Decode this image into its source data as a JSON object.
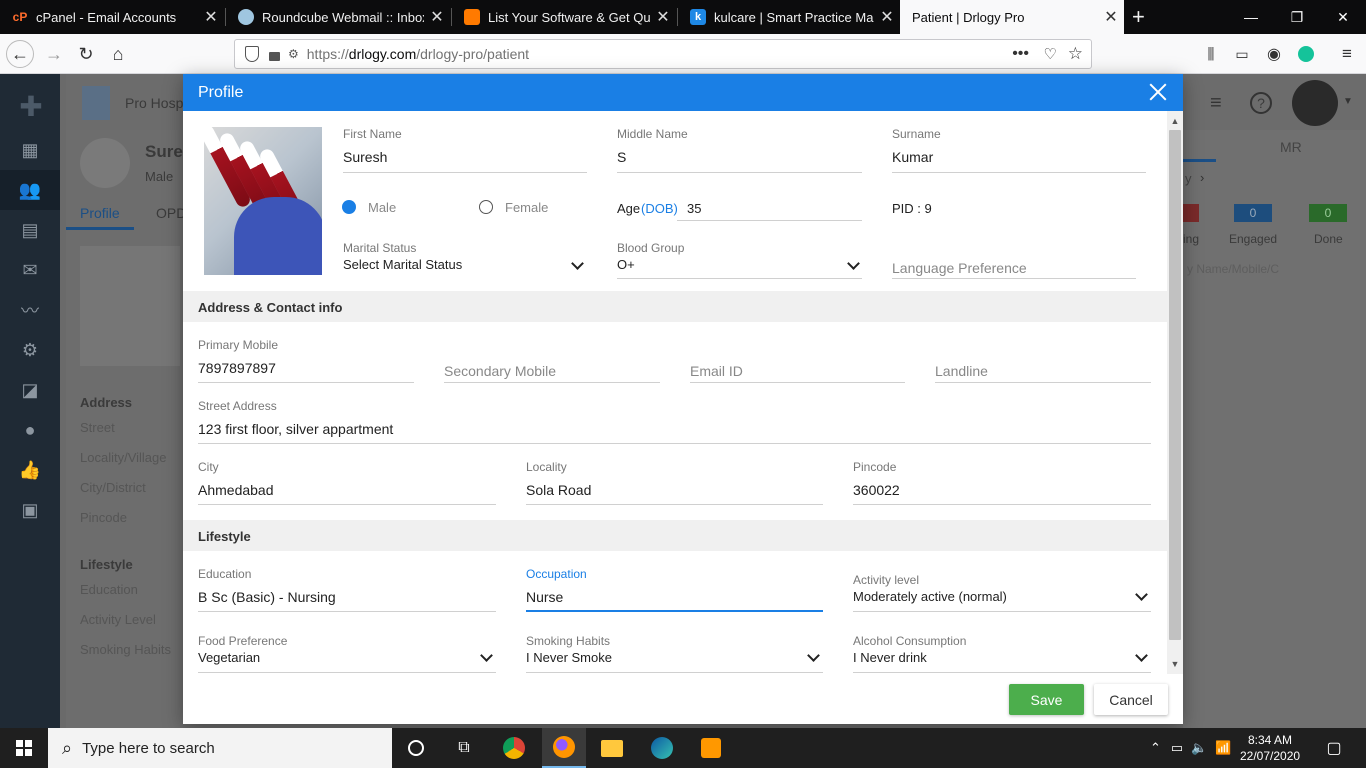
{
  "browser": {
    "tabs": [
      {
        "label": "cPanel - Email Accounts",
        "icon": "cpanel-icon",
        "color": "#ff6c2c"
      },
      {
        "label": "Roundcube Webmail :: Inbox",
        "icon": "roundcube-icon",
        "color": "#9fc6e0"
      },
      {
        "label": "List Your Software & Get Qualif",
        "icon": "chat-bubble-icon",
        "color": "#ff7a00"
      },
      {
        "label": "kulcare | Smart Practice Manag",
        "icon": "kulcare-icon",
        "color": "#1e88e5"
      },
      {
        "label": "Patient | Drlogy Pro",
        "icon": "none",
        "color": "#f9f9fa"
      }
    ],
    "new_tab": "+",
    "url": {
      "scheme": "https://",
      "host": "drlogy.com",
      "path": "/drlogy-pro/patient"
    }
  },
  "background": {
    "hospital_name": "Pro Hosp",
    "patient_name": "Sures",
    "patient_gender": "Male",
    "tabs": [
      "Profile",
      "OPD"
    ],
    "left_labels": [
      "Address",
      "Street",
      "Locality/Village",
      "City/District",
      "Pincode",
      "Lifestyle",
      "Education",
      "Activity Level",
      "Smoking Habits"
    ],
    "right_tab": "MR",
    "right_link": "y",
    "stats": [
      {
        "label": "ing",
        "value": ""
      },
      {
        "label": "Engaged",
        "value": "0"
      },
      {
        "label": "Done",
        "value": "0"
      }
    ],
    "right_search_placeholder": "y Name/Mobile/C"
  },
  "modal": {
    "title": "Profile",
    "first_name": {
      "label": "First Name",
      "value": "Suresh"
    },
    "middle_name": {
      "label": "Middle Name",
      "value": "S"
    },
    "surname": {
      "label": "Surname",
      "value": "Kumar"
    },
    "gender": {
      "male": "Male",
      "female": "Female",
      "selected": "Male"
    },
    "age": {
      "label": "Age",
      "dob_link": "(DOB)",
      "value": "35"
    },
    "pid": "PID : 9",
    "marital_status": {
      "label": "Marital Status",
      "value": "Select Marital Status"
    },
    "blood_group": {
      "label": "Blood Group",
      "value": "O+"
    },
    "language": {
      "placeholder": "Language Preference"
    },
    "address_section": "Address & Contact info",
    "primary_mobile": {
      "label": "Primary Mobile",
      "value": "7897897897"
    },
    "secondary_mobile": {
      "placeholder": "Secondary Mobile"
    },
    "email": {
      "placeholder": "Email ID"
    },
    "landline": {
      "placeholder": "Landline"
    },
    "street": {
      "label": "Street Address",
      "value": "123 first floor, silver appartment"
    },
    "city": {
      "label": "City",
      "value": "Ahmedabad"
    },
    "locality": {
      "label": "Locality",
      "value": "Sola Road"
    },
    "pincode": {
      "label": "Pincode",
      "value": "360022"
    },
    "lifestyle_section": "Lifestyle",
    "education": {
      "label": "Education",
      "value": "B Sc (Basic) - Nursing"
    },
    "occupation": {
      "label": "Occupation",
      "value": "Nurse"
    },
    "activity": {
      "label": "Activity level",
      "value": "Moderately active (normal)"
    },
    "food": {
      "label": "Food Preference",
      "value": "Vegetarian"
    },
    "smoking": {
      "label": "Smoking Habits",
      "value": "I Never Smoke"
    },
    "alcohol": {
      "label": "Alcohol Consumption",
      "value": "I Never drink"
    },
    "save_label": "Save",
    "cancel_label": "Cancel",
    "accent_color": "#1a7fe5",
    "save_color": "#4cae4c"
  },
  "taskbar": {
    "search_placeholder": "Type here to search",
    "time": "8:34 AM",
    "date": "22/07/2020"
  }
}
